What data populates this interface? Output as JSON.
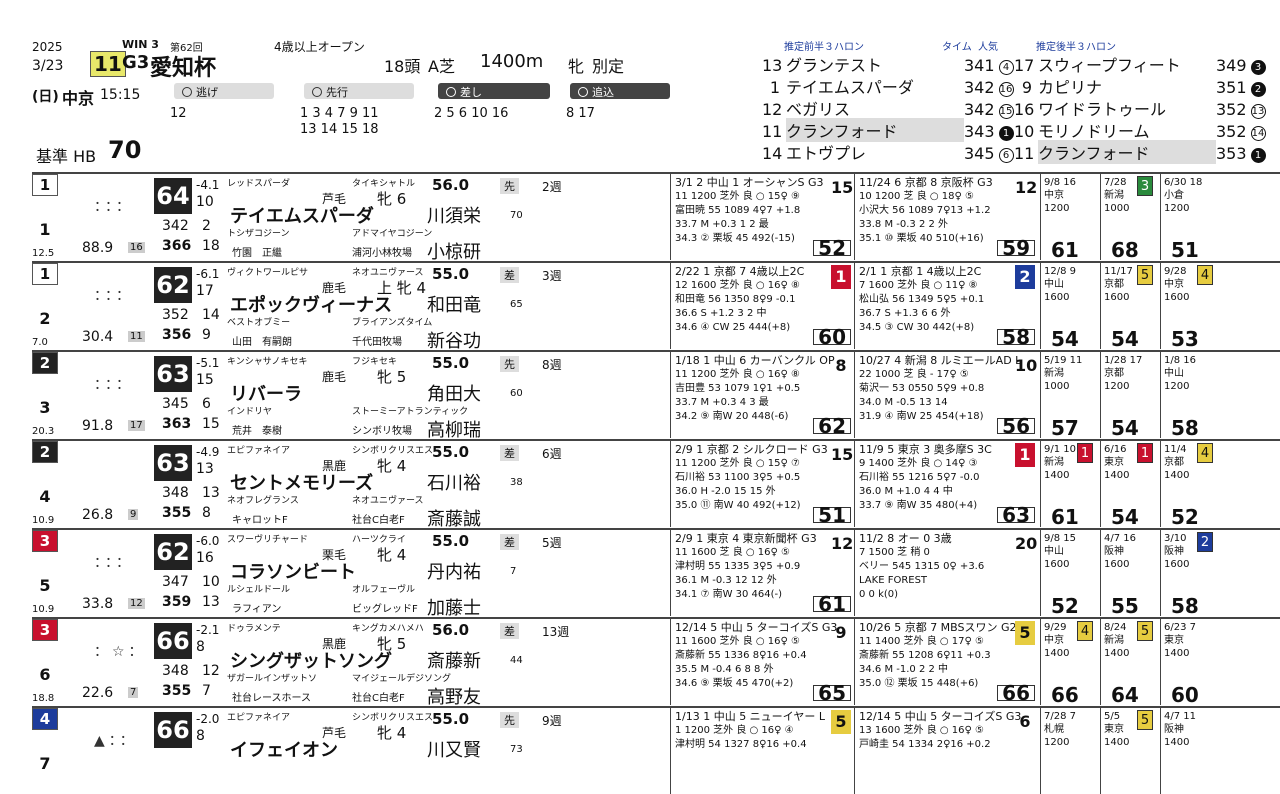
{
  "header": {
    "year": "2025",
    "date": "3/23",
    "day": "(日)",
    "venue": "中京",
    "time": "15:15",
    "race_no": "11",
    "grade": "G3",
    "race_name": "愛知杯",
    "win": "WIN 3",
    "edition": "第62回",
    "condition": "4歳以上オープン",
    "heads": "18頭",
    "course_type": "A芝",
    "distance": "1400m",
    "sex_cond": "牝",
    "weight_cond": "別定",
    "baseline": "基準 HB",
    "baseline_val": "70"
  },
  "legend": {
    "escape": "逃げ",
    "lead": "先行",
    "stalk": "差し",
    "closer": "追込",
    "escape_nums": "12",
    "lead_nums_1": "1  3  4  7  9 11",
    "lead_nums_2": "13 14 15 18",
    "stalk_nums": "2  5  6 10 16",
    "closer_nums": "8 17"
  },
  "pred_front": {
    "title": "推定前半３ハロン",
    "time_label": "タイム",
    "pop_label": "人気",
    "rows": [
      {
        "n": "13",
        "name": "グランテスト",
        "t": "341",
        "p": "4",
        "f": false,
        "hl": false
      },
      {
        "n": "1",
        "name": "テイエムスパーダ",
        "t": "342",
        "p": "16",
        "f": false,
        "hl": false
      },
      {
        "n": "12",
        "name": "ベガリス",
        "t": "342",
        "p": "15",
        "f": false,
        "hl": false
      },
      {
        "n": "11",
        "name": "クランフォード",
        "t": "343",
        "p": "1",
        "f": true,
        "hl": true
      },
      {
        "n": "14",
        "name": "エトヴプレ",
        "t": "345",
        "p": "6",
        "f": false,
        "hl": false
      }
    ]
  },
  "pred_back": {
    "title": "推定後半３ハロン",
    "rows": [
      {
        "n": "17",
        "name": "スウィープフィート",
        "t": "349",
        "p": "3",
        "f": true,
        "hl": false
      },
      {
        "n": "9",
        "name": "カピリナ",
        "t": "351",
        "p": "2",
        "f": true,
        "hl": false
      },
      {
        "n": "16",
        "name": "ワイドラトゥール",
        "t": "352",
        "p": "13",
        "f": false,
        "hl": false
      },
      {
        "n": "10",
        "name": "モリノドリーム",
        "t": "352",
        "p": "14",
        "f": false,
        "hl": false
      },
      {
        "n": "11",
        "name": "クランフォード",
        "t": "353",
        "p": "1",
        "f": true,
        "hl": true
      }
    ]
  },
  "horses": [
    {
      "gate": "1",
      "num": "1",
      "odd": "12.5",
      "marks": "：：：",
      "idx": "88.9",
      "idxr": "16",
      "spd": "64",
      "r1": "-4.1",
      "r2": "10",
      "s1": "342",
      "s1b": "2",
      "s2": "366",
      "s2b": "18",
      "sire": "レッドスパーダ",
      "damsire": "タイキシャトル",
      "coat": "芦毛",
      "sex": "牝 6",
      "name": "テイエムスパーダ",
      "dam": "トシザコジーン",
      "dam2": "アドマイヤコジーン",
      "own": "竹園　正繼",
      "farm": "浦河小林牧場",
      "wt": "56.0",
      "jockey": "川須栄",
      "jw": "70",
      "trainer": "小椋研",
      "style": "先",
      "rot": "2週",
      "p1": {
        "h": "3/1  2 中山 1 オーシャンS  G3",
        "r": "15",
        "l2": "11  1200 芝外 良 ○ 15♀ ⑨",
        "l3": "富田暁 55 1089  4♀7  +1.8",
        "l4": "33.7 M +0.3   1 2 最",
        "l5": "34.3 ② 栗坂 45 492(-15)",
        "f": "52",
        "rk": "",
        "rkc": "bg-w"
      },
      "p2": {
        "h": "11/24 6 京都 8 京阪杯  G3",
        "r": "12",
        "l2": "10  1200 芝 良 ○ 18♀ ⑤",
        "l3": "小沢大 56 1089  7♀13  +1.2",
        "l4": "33.8 M -0.3   2 2 外",
        "l5": "35.1 ⑩ 栗坂 40 510(+16)",
        "f": "59",
        "rk": "",
        "rkc": "bg-w"
      },
      "m": [
        {
          "h": "9/8 16",
          "v": "中京 1200",
          "f": "61",
          "bx": "",
          "c": "bg-w"
        },
        {
          "h": "7/28",
          "v": "新潟 1000",
          "f": "68",
          "bx": "3",
          "c": "bg-g"
        },
        {
          "h": "6/30 18",
          "v": "小倉 1200",
          "f": "51",
          "bx": "",
          "c": "bg-w"
        }
      ]
    },
    {
      "gate": "1",
      "num": "2",
      "odd": "7.0",
      "marks": "：：：",
      "idx": "30.4",
      "idxr": "11",
      "spd": "62",
      "r1": "-6.1",
      "r2": "17",
      "s1": "352",
      "s1b": "14",
      "s2": "356",
      "s2b": "9",
      "sire": "ヴィクトワールピサ",
      "damsire": "ネオユニヴァース",
      "coat": "鹿毛",
      "sex": "上 牝 4",
      "name": "エポックヴィーナス",
      "dam": "ベストオブミー",
      "dam2": "ブライアンズタイム",
      "own": "山田　有嗣朗",
      "farm": "千代田牧場",
      "wt": "55.0",
      "jockey": "和田竜",
      "jw": "65",
      "trainer": "新谷功",
      "style": "差",
      "rot": "3週",
      "p1": {
        "h": "2/22  1 京都 7 4歳以上2C",
        "r": "12",
        "l2": "12  1600 芝外 良 ○ 16♀ ⑧",
        "l3": "和田竜 56 1350  8♀9  -0.1",
        "l4": "36.6 S +1.2   3 2 中",
        "l5": "34.6 ④ CW 25 444(+8)",
        "f": "60",
        "rk": "1",
        "rkc": "bg-r"
      },
      "p2": {
        "h": "2/1  1 京都 1 4歳以上2C",
        "r": "11",
        "l2": "7  1600 芝外 良 ○ 11♀ ⑧",
        "l3": "松山弘 56 1349  5♀5  +0.1",
        "l4": "36.7 S +1.3   6 6 外",
        "l5": "34.5 ③ CW 30 442(+8)",
        "f": "58",
        "rk": "2",
        "rkc": "bg-b"
      },
      "m": [
        {
          "h": "12/8 9",
          "v": "中山 1600",
          "f": "54",
          "bx": "",
          "c": "bg-w"
        },
        {
          "h": "11/17",
          "v": "京都 1600",
          "f": "54",
          "bx": "5",
          "c": "bg-y"
        },
        {
          "h": "9/28",
          "v": "中京 1600",
          "f": "53",
          "bx": "4",
          "c": "bg-y"
        }
      ]
    },
    {
      "gate": "2",
      "num": "3",
      "odd": "20.3",
      "marks": "：：：",
      "idx": "91.8",
      "idxr": "17",
      "spd": "63",
      "r1": "-5.1",
      "r2": "15",
      "s1": "345",
      "s1b": "6",
      "s2": "363",
      "s2b": "15",
      "sire": "キンシャサノキセキ",
      "damsire": "フジキセキ",
      "coat": "鹿毛",
      "sex": "牝 5",
      "name": "リバーラ",
      "dam": "インドリヤ",
      "dam2": "ストーミーアトランティック",
      "own": "荒井　泰樹",
      "farm": "シンボリ牧場",
      "wt": "55.0",
      "jockey": "角田大",
      "jw": "60",
      "trainer": "高柳瑞",
      "style": "先",
      "rot": "8週",
      "p1": {
        "h": "1/18  1 中山 6 カーバンクル OP",
        "r": "8",
        "l2": "11  1200 芝外 良 ○ 16♀ ⑧",
        "l3": "吉田豊 53 1079  1♀1  +0.5",
        "l4": "33.7 M +0.3   4 3 最",
        "l5": "34.2 ⑨ 南W 20 448(-6)",
        "f": "62",
        "rk": "",
        "rkc": "bg-w"
      },
      "p2": {
        "h": "10/27 4 新潟 8 ルミエールAD L",
        "r": "10",
        "l2": "22  1000 芝 良 - 17♀ ⑤",
        "l3": "菊沢一 53 0550  5♀9  +0.8",
        "l4": "34.0 M -0.5   13 14",
        "l5": "31.9 ④ 南W 25 454(+18)",
        "f": "56",
        "rk": "",
        "rkc": "bg-w"
      },
      "m": [
        {
          "h": "5/19 11",
          "v": "新潟 1000",
          "f": "57",
          "bx": "",
          "c": "bg-w"
        },
        {
          "h": "1/28 17",
          "v": "京都 1200",
          "f": "54",
          "bx": "",
          "c": "bg-w"
        },
        {
          "h": "1/8 16",
          "v": "中山 1200",
          "f": "58",
          "bx": "",
          "c": "bg-w"
        }
      ]
    },
    {
      "gate": "2",
      "num": "4",
      "odd": "10.9",
      "marks": "",
      "idx": "26.8",
      "idxr": "9",
      "spd": "63",
      "r1": "-4.9",
      "r2": "13",
      "s1": "348",
      "s1b": "13",
      "s2": "355",
      "s2b": "8",
      "sire": "エピファネイア",
      "damsire": "シンボリクリスエス",
      "coat": "黒鹿",
      "sex": "牝 4",
      "name": "セントメモリーズ",
      "dam": "ネオフレグランス",
      "dam2": "ネオユニヴァース",
      "own": "キャロットF",
      "farm": "社台C白老F",
      "wt": "55.0",
      "jockey": "石川裕",
      "jw": "38",
      "trainer": "斎藤誠",
      "style": "差",
      "rot": "6週",
      "p1": {
        "h": "2/9  1 京都 2 シルクロード G3",
        "r": "15",
        "l2": "11  1200 芝外 良 ○ 15♀ ⑦",
        "l3": "石川裕 53 1100  3♀5  +0.5",
        "l4": "36.0 H -2.0   15 15 外",
        "l5": "35.0 ⑪ 南W 40 492(+12)",
        "f": "51",
        "rk": "",
        "rkc": "bg-w"
      },
      "p2": {
        "h": "11/9  5 東京 3 奥多摩S 3C",
        "r": "1",
        "l2": "9  1400 芝外 良 ○ 14♀ ③",
        "l3": "石川裕 55 1216  5♀7  -0.0",
        "l4": "36.0 M +1.0   4 4 中",
        "l5": "33.7 ⑨ 南W 35 480(+4)",
        "f": "63",
        "rk": "1",
        "rkc": "bg-r"
      },
      "m": [
        {
          "h": "9/1 10",
          "v": "新潟 1400",
          "f": "61",
          "bx": "1",
          "c": "bg-r"
        },
        {
          "h": "6/16",
          "v": "東京 1400",
          "f": "54",
          "bx": "1",
          "c": "bg-r"
        },
        {
          "h": "11/4",
          "v": "京都 1400",
          "f": "52",
          "bx": "4",
          "c": "bg-y"
        }
      ]
    },
    {
      "gate": "3",
      "num": "5",
      "odd": "10.9",
      "marks": "：：：",
      "idx": "33.8",
      "idxr": "12",
      "spd": "62",
      "r1": "-6.0",
      "r2": "16",
      "s1": "347",
      "s1b": "10",
      "s2": "359",
      "s2b": "13",
      "sire": "スワーヴリチャード",
      "damsire": "ハーツクライ",
      "coat": "栗毛",
      "sex": "牝 4",
      "name": "コラソンビート",
      "dam": "ルシェルドール",
      "dam2": "オルフェーヴル",
      "own": "ラフィアン",
      "farm": "ビッグレッドF",
      "wt": "55.0",
      "jockey": "丹内祐",
      "jw": "7",
      "trainer": "加藤士",
      "style": "差",
      "rot": "5週",
      "p1": {
        "h": "2/9  1 東京 4 東京新聞杯 G3",
        "r": "12",
        "l2": "11  1600 芝 良 ○ 16♀ ⑤",
        "l3": "津村明 55 1335  3♀5  +0.9",
        "l4": "36.1 M -0.3   12 12 外",
        "l5": "34.1 ⑦ 南W 30 464(-)",
        "f": "61",
        "rk": "",
        "rkc": "bg-w"
      },
      "p2": {
        "h": "11/2  8 オー 0 3歳",
        "r": "20",
        "l2": "7  1500 芝 稍 0",
        "l3": "ベリー 545 1315  0♀  +3.6",
        "l4": "LAKE FOREST",
        "l5": "0 0  k(0)",
        "f": "",
        "rk": "",
        "rkc": "bg-w"
      },
      "m": [
        {
          "h": "9/8 15",
          "v": "中山 1600",
          "f": "52",
          "bx": "",
          "c": "bg-w"
        },
        {
          "h": "4/7 16",
          "v": "阪神 1600",
          "f": "55",
          "bx": "",
          "c": "bg-w"
        },
        {
          "h": "3/10",
          "v": "阪神 1600",
          "f": "58",
          "bx": "2",
          "c": "bg-b"
        }
      ]
    },
    {
      "gate": "3",
      "num": "6",
      "odd": "18.8",
      "marks": "：☆：",
      "idx": "22.6",
      "idxr": "7",
      "spd": "66",
      "r1": "-2.1",
      "r2": "8",
      "s1": "348",
      "s1b": "12",
      "s2": "355",
      "s2b": "7",
      "sire": "ドゥラメンテ",
      "damsire": "キングカメハメハ",
      "coat": "黒鹿",
      "sex": "牝 5",
      "name": "シングザットソング",
      "dam": "ザガールインザットソ",
      "dam2": "マイジェールデジソング",
      "own": "社台レースホース",
      "farm": "社台C白老F",
      "wt": "56.0",
      "jockey": "斎藤新",
      "jw": "44",
      "trainer": "高野友",
      "style": "差",
      "rot": "13週",
      "p1": {
        "h": "12/14 5 中山 5 ターコイズS G3",
        "r": "9",
        "l2": "11  1600 芝外 良 ○ 16♀ ⑤",
        "l3": "斎藤新 55 1336  8♀16  +0.4",
        "l4": "35.5 M -0.4   6 8 8 外",
        "l5": "34.6 ⑨ 栗坂 45 470(+2)",
        "f": "65",
        "rk": "",
        "rkc": "bg-w"
      },
      "p2": {
        "h": "10/26 5 京都 7 MBSスワン G2",
        "r": "",
        "l2": "11  1400 芝外 良 ○ 17♀ ⑤",
        "l3": "斎藤新 55 1208  6♀11  +0.3",
        "l4": "34.6 M -1.0   2 2 中",
        "l5": "35.0 ⑫ 栗坂 15 448(+6)",
        "f": "66",
        "rk": "5",
        "rkc": "bg-y"
      },
      "m": [
        {
          "h": "9/29",
          "v": "中京 1400",
          "f": "66",
          "bx": "4",
          "c": "bg-y"
        },
        {
          "h": "8/24",
          "v": "新潟 1400",
          "f": "64",
          "bx": "5",
          "c": "bg-y"
        },
        {
          "h": "6/23 7",
          "v": "東京 1400",
          "f": "60",
          "bx": "",
          "c": "bg-w"
        }
      ]
    },
    {
      "gate": "4",
      "num": "7",
      "odd": "",
      "marks": "▲：：",
      "idx": "",
      "idxr": "",
      "spd": "66",
      "r1": "-2.0",
      "r2": "8",
      "s1": "",
      "s1b": "",
      "s2": "",
      "s2b": "",
      "sire": "エピファネイア",
      "damsire": "シンボリクリスエス",
      "coat": "芦毛",
      "sex": "牝 4",
      "name": "イフェイオン",
      "dam": "",
      "dam2": "",
      "own": "",
      "farm": "",
      "wt": "55.0",
      "jockey": "川又賢",
      "jw": "73",
      "trainer": "",
      "style": "先",
      "rot": "9週",
      "p1": {
        "h": "1/13  1 中山 5 ニューイヤー L",
        "r": "",
        "l2": "1 1200 芝外 良 ○ 16♀ ④",
        "l3": "津村明 54 1327  8♀16  +0.4",
        "l4": "",
        "l5": "",
        "f": "",
        "rk": "5",
        "rkc": "bg-y"
      },
      "p2": {
        "h": "12/14 5 中山 5 ターコイズS G3",
        "r": "6",
        "l2": "13  1600 芝外 良 ○ 16♀ ⑤",
        "l3": "戸崎圭 54 1334  2♀16  +0.2",
        "l4": "",
        "l5": "",
        "f": "",
        "rk": "",
        "rkc": "bg-w"
      },
      "m": [
        {
          "h": "7/28 7",
          "v": "札幌 1200",
          "f": "",
          "bx": "",
          "c": "bg-w"
        },
        {
          "h": "5/5",
          "v": "東京 1400",
          "f": "",
          "bx": "5",
          "c": "bg-y"
        },
        {
          "h": "4/7 11",
          "v": "阪神 1400",
          "f": "",
          "bx": "",
          "c": "bg-w"
        }
      ]
    }
  ]
}
